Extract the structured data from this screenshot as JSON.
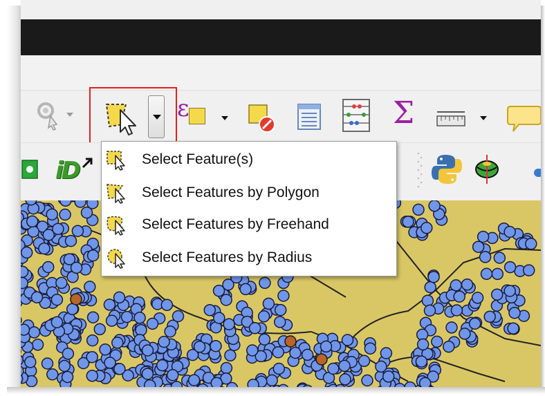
{
  "toolbar": {
    "select_dropdown_open": true
  },
  "select_menu": {
    "items": [
      {
        "label": "Select Feature(s)",
        "icon": "select-rectangle-icon"
      },
      {
        "label": "Select Features by Polygon",
        "icon": "select-polygon-icon"
      },
      {
        "label": "Select Features by Freehand",
        "icon": "select-freehand-icon"
      },
      {
        "label": "Select Features by Radius",
        "icon": "select-radius-icon"
      }
    ]
  },
  "colors": {
    "map_background": "#d9c766",
    "point_fill": "#6f96e8",
    "point_highlight": "#b8642a",
    "highlight_box": "#e0201d",
    "sigma": "#9b1fa5"
  }
}
